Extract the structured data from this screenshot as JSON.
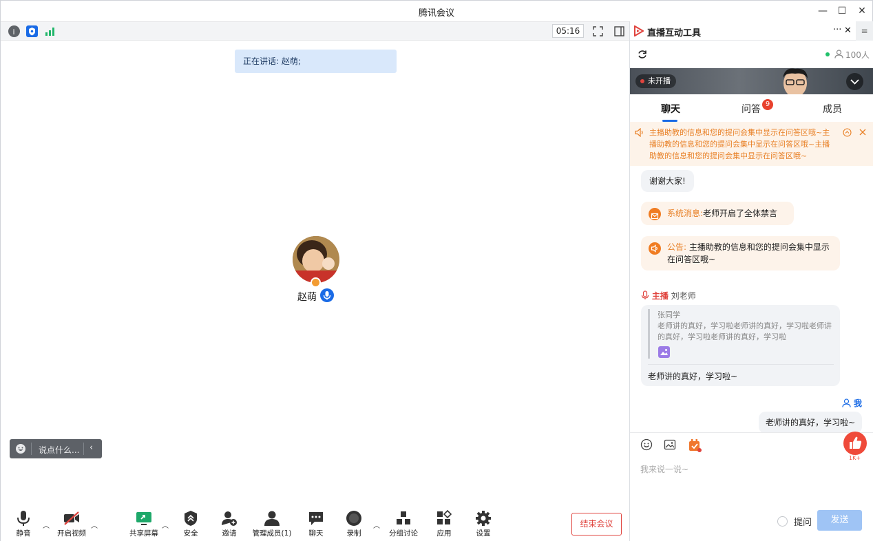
{
  "window": {
    "title": "腾讯会议",
    "minimize": "—",
    "maximize": "☐",
    "close": "✕"
  },
  "topbar": {
    "timer": "05:16"
  },
  "stage": {
    "speaking": "正在讲话: 赵萌;",
    "participant_name": "赵萌",
    "danmu_placeholder": "说点什么..."
  },
  "toolbar": {
    "mute": "静音",
    "video": "开启视频",
    "share": "共享屏幕",
    "security": "安全",
    "invite": "邀请",
    "members": "管理成员(1)",
    "chat": "聊天",
    "record": "录制",
    "breakout": "分组讨论",
    "apps": "应用",
    "settings": "设置",
    "end": "结束会议"
  },
  "panel": {
    "title": "直播互动工具",
    "more": "···",
    "close": "✕",
    "menu": "≡",
    "people": "100人",
    "live_status": "未开播",
    "tabs": [
      "聊天",
      "问答",
      "成员"
    ],
    "qa_badge": "9",
    "notice": "主播助教的信息和您的提问会集中显示在问答区哦~主播助教的信息和您的提问会集中显示在问答区哦~主播助教的信息和您的提问会集中显示在问答区哦~",
    "messages": {
      "thanks": "谢谢大家!",
      "sys_label": "系统消息:",
      "sys_text": "老师开启了全体禁言",
      "ann_label": "公告:",
      "ann_text": "主播助教的信息和您的提问会集中显示在问答区哦~",
      "host_tag": "主播",
      "host_name": "刘老师",
      "quote_author": "张同学",
      "quote_text": "老师讲的真好，学习啦老师讲的真好，学习啦老师讲的真好，学习啦老师讲的真好，学习啦",
      "host_reply": "老师讲的真好，学习啦~",
      "me_label": "我",
      "my_text": "老师讲的真好，学习啦~"
    },
    "input": {
      "placeholder": "我来说一说~",
      "like_count": "1K+",
      "ask_label": "提问",
      "send": "发送"
    }
  },
  "colors": {
    "accent": "#1a6be6",
    "danger": "#e0443e",
    "orange": "#e87f24"
  }
}
